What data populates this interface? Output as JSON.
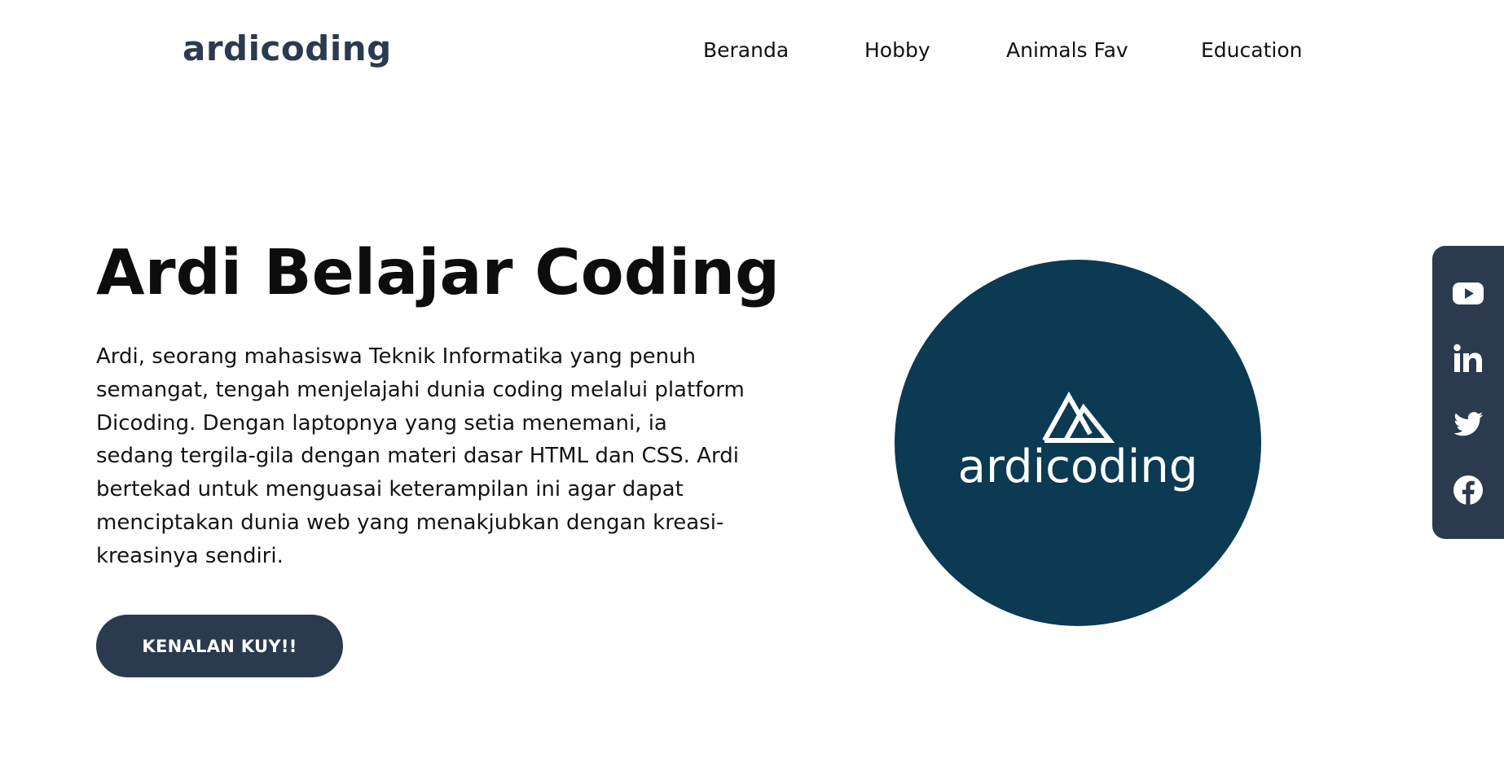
{
  "header": {
    "logo": "ardicoding",
    "nav": [
      "Beranda",
      "Hobby",
      "Animals Fav",
      "Education"
    ]
  },
  "hero": {
    "title": "Ardi Belajar Coding",
    "description": "Ardi, seorang mahasiswa Teknik Informatika yang penuh semangat, tengah menjelajahi dunia coding melalui platform Dicoding. Dengan laptopnya yang setia menemani, ia sedang tergila-gila dengan materi dasar HTML dan CSS. Ardi bertekad untuk menguasai keterampilan ini agar dapat menciptakan dunia web yang menakjubkan dengan kreasi-kreasinya sendiri.",
    "cta": "KENALAN KUY!!"
  },
  "brand_badge": {
    "text": "ardicoding",
    "background": "#0b3a52"
  },
  "social": {
    "icons": [
      "youtube-icon",
      "linkedin-icon",
      "twitter-icon",
      "facebook-icon"
    ],
    "background": "#2b3a4f"
  },
  "colors": {
    "primary": "#2b3a4f",
    "badge": "#0b3a52",
    "text": "#111111"
  }
}
